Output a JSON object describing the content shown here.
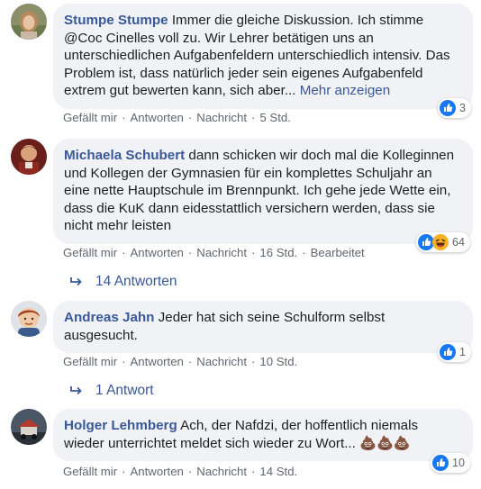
{
  "comments": [
    {
      "author": "Stumpe Stumpe",
      "text": " Immer die gleiche Diskussion. Ich stimme @Coc Cinelles voll zu. Wir Lehrer betätigen uns an unterschiedlichen Aufgabenfeldern unterschiedlich intensiv. Das Problem ist, dass natürlich jeder sein eigenes Aufgabenfeld extrem gut bewerten kann, sich aber... ",
      "more": "Mehr anzeigen",
      "like": "Gefällt mir",
      "reply": "Antworten",
      "message": "Nachricht",
      "time": "5 Std.",
      "reaction_count": "3"
    },
    {
      "author": "Michaela Schubert",
      "text": " dann schicken wir doch mal die Kolleginnen und Kollegen der Gymnasien für ein komplettes Schuljahr an eine nette Hauptschule im Brennpunkt. Ich gehe jede Wette ein, dass die KuK dann eidesstattlich versichern werden, dass sie nicht mehr leisten",
      "like": "Gefällt mir",
      "reply": "Antworten",
      "message": "Nachricht",
      "time": "16 Std.",
      "edited": "Bearbeitet",
      "reaction_count": "64",
      "replies": "14 Antworten"
    },
    {
      "author": "Andreas Jahn",
      "text": " Jeder hat sich seine Schulform selbst ausgesucht.",
      "like": "Gefällt mir",
      "reply": "Antworten",
      "message": "Nachricht",
      "time": "10 Std.",
      "reaction_count": "1",
      "replies": "1 Antwort"
    },
    {
      "author": "Holger Lehmberg",
      "text": " Ach, der Nafdzi, der hoffentlich niemals wieder unterrichtet meldet sich wieder zu Wort... ",
      "emoji": "💩💩💩",
      "like": "Gefällt mir",
      "reply": "Antworten",
      "message": "Nachricht",
      "time": "14 Std.",
      "reaction_count": "10"
    }
  ],
  "icons": {
    "like": "like-reaction-icon",
    "haha": "haha-reaction-icon",
    "reply_arrow": "reply-arrow-icon"
  },
  "colors": {
    "link": "#385898",
    "like_blue": "#1877f2",
    "bubble": "#f0f2f5",
    "meta": "#606770"
  }
}
